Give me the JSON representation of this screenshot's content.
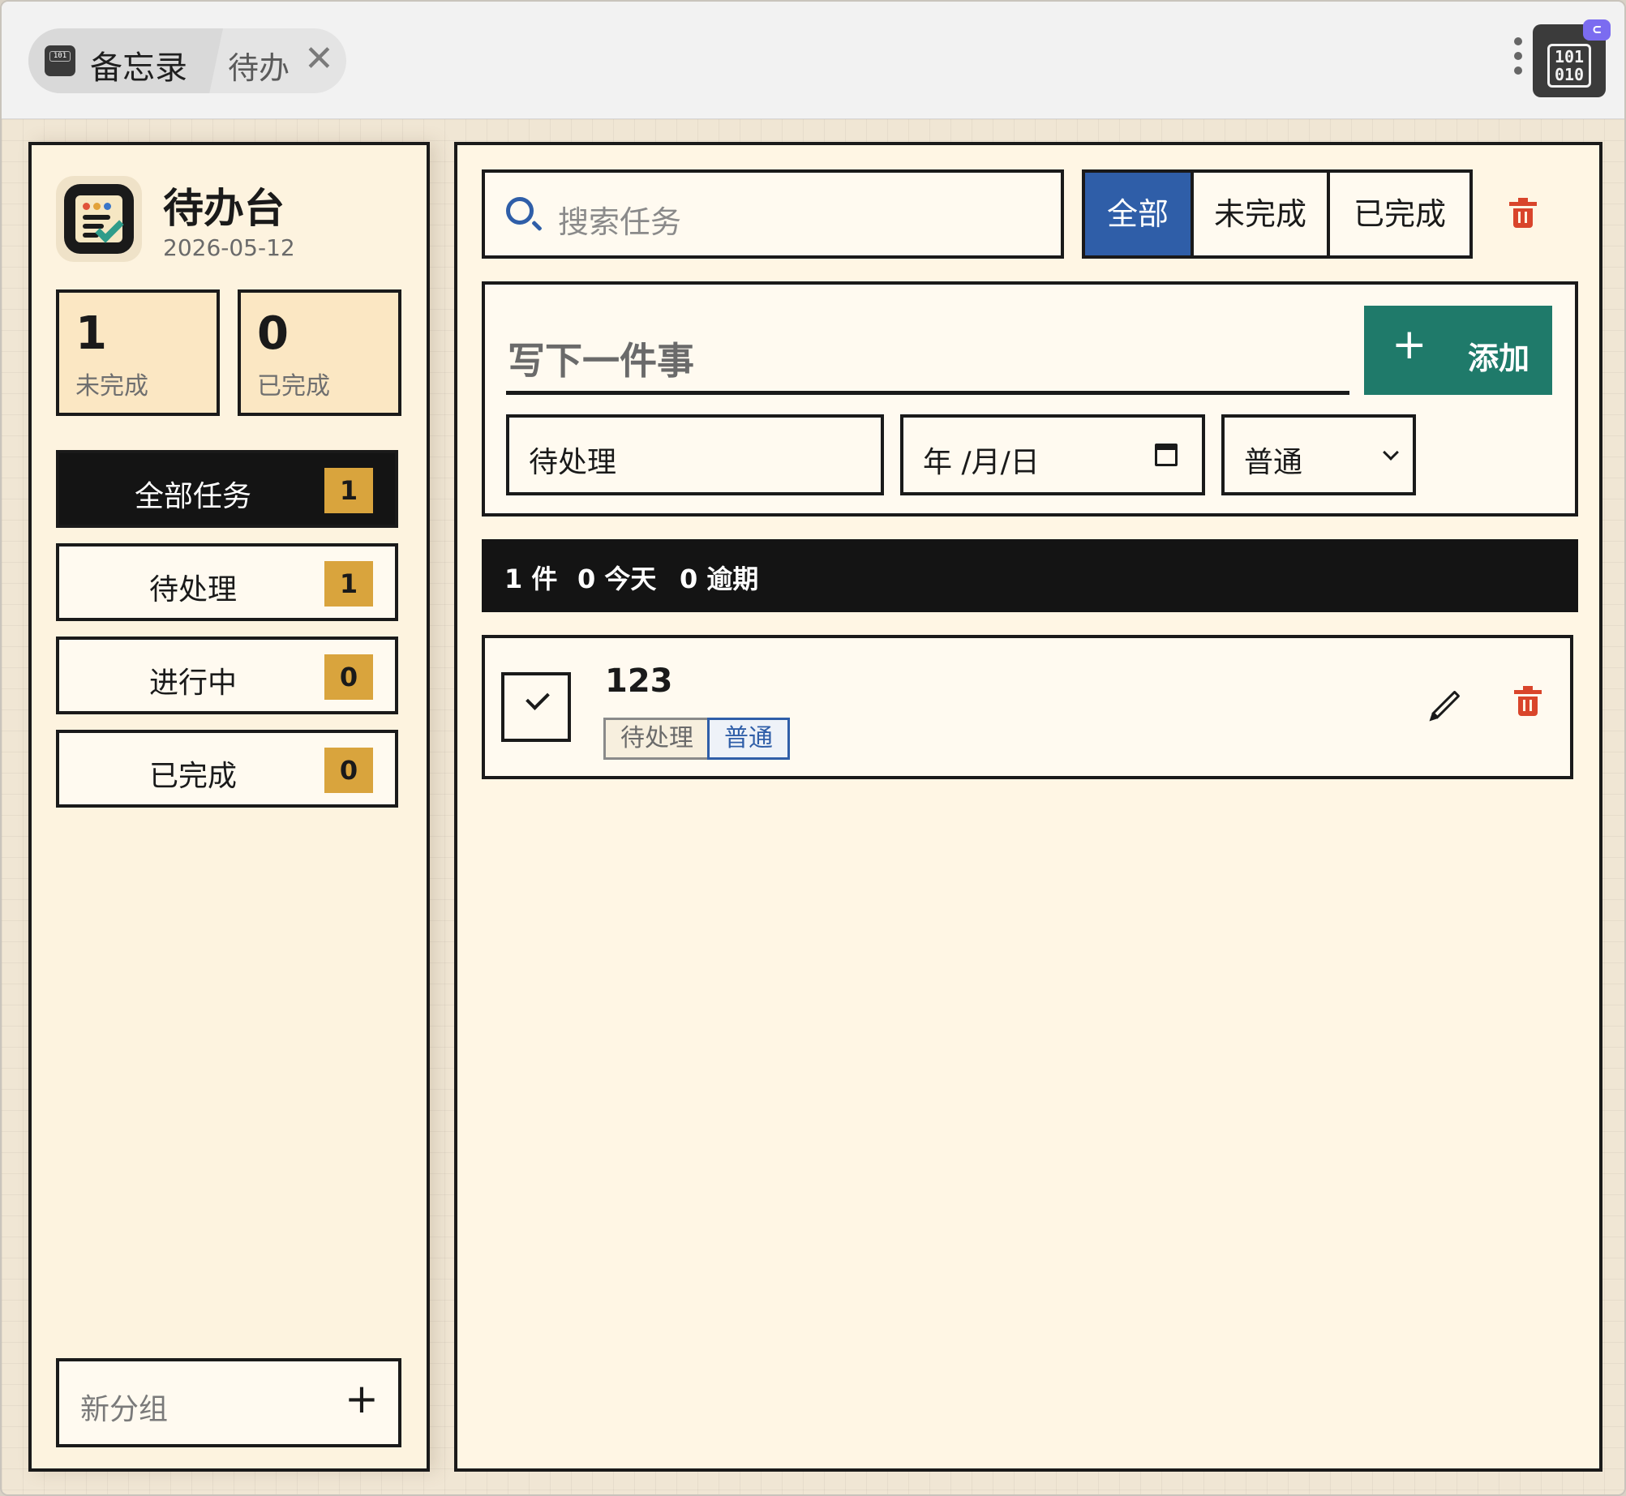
{
  "titlebar": {
    "app_name": "备忘录",
    "tab_name": "待办",
    "close_glyph": "✕",
    "plugin_icon": "binary-icon"
  },
  "sidebar": {
    "app_title": "待办台",
    "date": "2026-05-12",
    "stats": [
      {
        "value": "1",
        "label": "未完成"
      },
      {
        "value": "0",
        "label": "已完成"
      }
    ],
    "nav": [
      {
        "label": "全部任务",
        "count": "1",
        "active": true
      },
      {
        "label": "待处理",
        "count": "1",
        "active": false
      },
      {
        "label": "进行中",
        "count": "0",
        "active": false
      },
      {
        "label": "已完成",
        "count": "0",
        "active": false
      }
    ],
    "new_group_placeholder": "新分组",
    "new_group_add": "+"
  },
  "main": {
    "search_placeholder": "搜索任务",
    "filters": [
      {
        "label": "全部",
        "active": true
      },
      {
        "label": "未完成",
        "active": false
      },
      {
        "label": "已完成",
        "active": false
      }
    ],
    "composer": {
      "title_placeholder": "写下一件事",
      "add_plus": "+",
      "add_label": "添加",
      "status_value": "待处理",
      "date_placeholder": "年 /月/日",
      "priority_value": "普通"
    },
    "summary": {
      "count": "1 件",
      "today": "0 今天",
      "overdue": "0 逾期"
    },
    "tasks": [
      {
        "title": "123",
        "status": "待处理",
        "priority": "普通",
        "done": false
      }
    ]
  },
  "colors": {
    "accent_blue": "#2f5ea8",
    "accent_green": "#1f7a6a",
    "badge_gold": "#d9a43d",
    "danger_red": "#d9452b",
    "ink": "#1a1a1a"
  }
}
